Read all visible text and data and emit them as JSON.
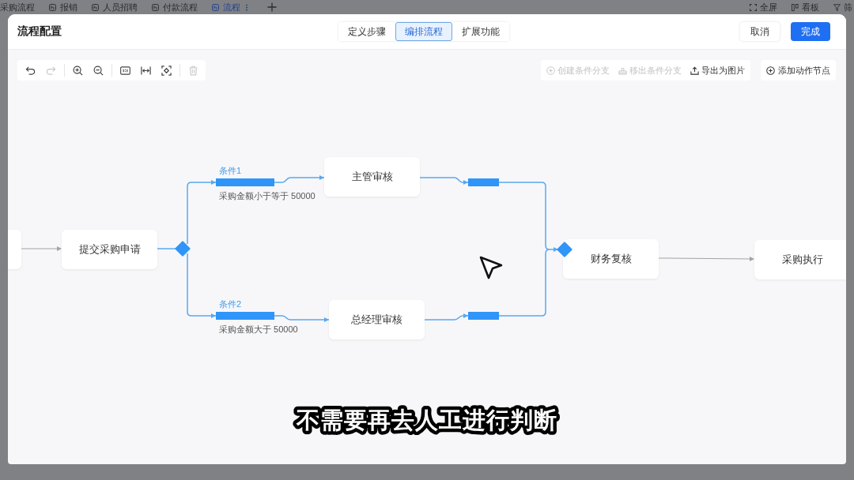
{
  "app_tabs": [
    {
      "label": "采购流程",
      "selected": false
    },
    {
      "label": "报销",
      "selected": false
    },
    {
      "label": "人员招聘",
      "selected": false
    },
    {
      "label": "付款流程",
      "selected": false
    },
    {
      "label": "流程",
      "selected": true
    }
  ],
  "app_actions": [
    {
      "kind": "fullscreen",
      "label": "全屏"
    },
    {
      "kind": "board",
      "label": "看板"
    },
    {
      "kind": "filter",
      "label": "筛"
    }
  ],
  "dialog": {
    "title": "流程配置",
    "steps": [
      {
        "label": "定义步骤",
        "selected": false
      },
      {
        "label": "编排流程",
        "selected": true
      },
      {
        "label": "扩展功能",
        "selected": false
      }
    ],
    "buttons": [
      {
        "kind": "secondary",
        "label": "取消"
      },
      {
        "kind": "primary",
        "label": "完成"
      }
    ]
  },
  "toolbar": {
    "tool_groups": [
      [
        {
          "kind": "undo",
          "disabled": false
        },
        {
          "kind": "redo",
          "disabled": true
        }
      ],
      [
        {
          "kind": "zoomin",
          "disabled": false
        },
        {
          "kind": "zoomout",
          "disabled": false
        }
      ],
      [
        {
          "kind": "actualsize",
          "disabled": false
        },
        {
          "kind": "fitwidth",
          "disabled": false
        },
        {
          "kind": "fitview",
          "disabled": false
        }
      ],
      [
        {
          "kind": "delete",
          "disabled": true
        }
      ]
    ],
    "actions": [
      {
        "kind": "add",
        "label": "创建条件分支",
        "disabled": true
      },
      {
        "kind": "remove",
        "label": "移出条件分支",
        "disabled": true
      },
      {
        "kind": "export",
        "label": "导出为图片",
        "disabled": false
      }
    ],
    "add_node": {
      "label": "添加动作节点"
    }
  },
  "flow": {
    "nodes": [
      {
        "kind": "partial"
      },
      {
        "kind": "task",
        "label": "提交采购申请"
      },
      {
        "kind": "task",
        "label": "财务复核"
      },
      {
        "kind": "task",
        "label": "采购执行"
      }
    ],
    "branches": [
      {
        "label": "条件1",
        "condition": "采购金额小于等于 50000",
        "node": "主管审核"
      },
      {
        "label": "条件2",
        "condition": "采购金额大于 50000",
        "node": "总经理审核"
      }
    ]
  },
  "caption": "不需要再去人工进行判断"
}
